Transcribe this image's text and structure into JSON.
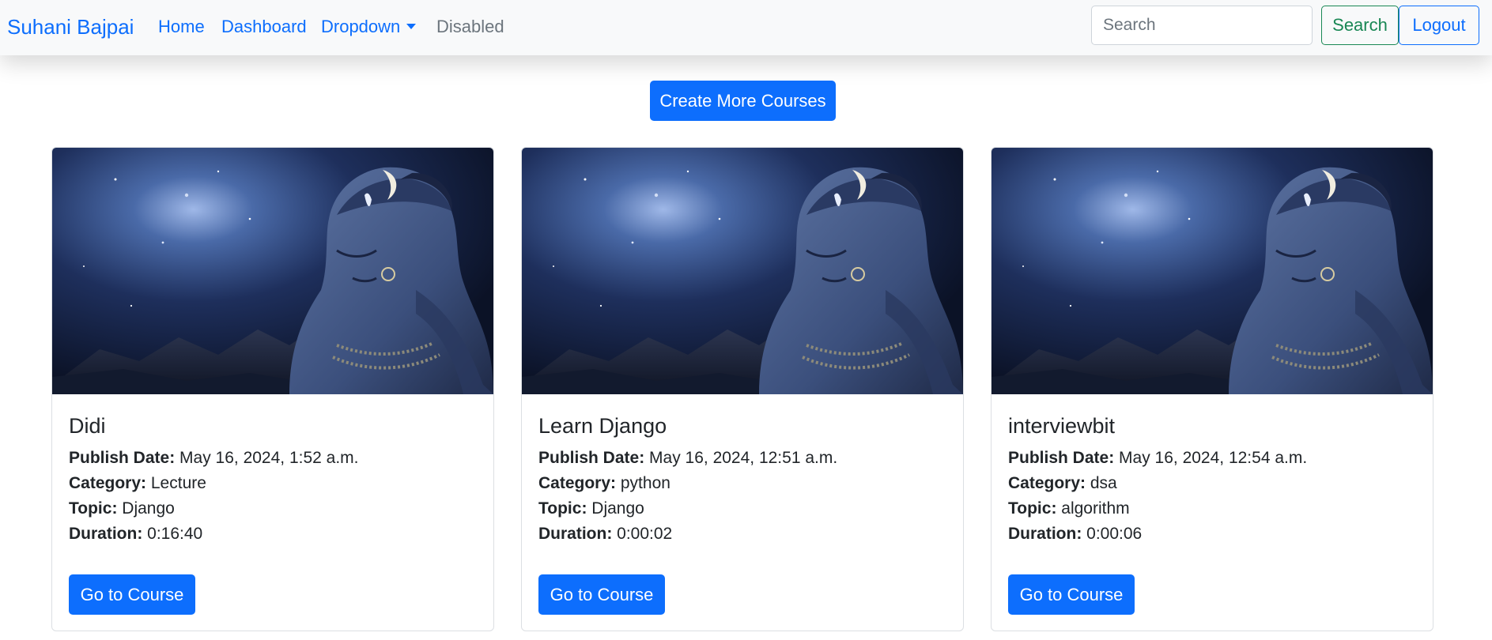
{
  "navbar": {
    "brand": "Suhani Bajpai",
    "links": [
      {
        "label": "Home"
      },
      {
        "label": "Dashboard"
      },
      {
        "label": "Dropdown"
      },
      {
        "label": "Disabled"
      }
    ],
    "search_placeholder": "Search",
    "search_button": "Search",
    "logout_button": "Logout"
  },
  "main": {
    "create_button": "Create More Courses",
    "labels": {
      "publish_date": "Publish Date:",
      "category": "Category:",
      "topic": "Topic:",
      "duration": "Duration:"
    },
    "courses": [
      {
        "title": "Didi",
        "publish_date": "May 16, 2024, 1:52 a.m.",
        "category": "Lecture",
        "topic": "Django",
        "duration": "0:16:40",
        "button": "Go to Course"
      },
      {
        "title": "Learn Django",
        "publish_date": "May 16, 2024, 12:51 a.m.",
        "category": "python",
        "topic": "Django",
        "duration": "0:00:02",
        "button": "Go to Course"
      },
      {
        "title": "interviewbit",
        "publish_date": "May 16, 2024, 12:54 a.m.",
        "category": "dsa",
        "topic": "algorithm",
        "duration": "0:00:06",
        "button": "Go to Course"
      }
    ]
  },
  "colors": {
    "primary": "#0d6efd",
    "success": "#198754",
    "secondary": "#6c757d",
    "navbar_bg": "#f8f9fa"
  }
}
